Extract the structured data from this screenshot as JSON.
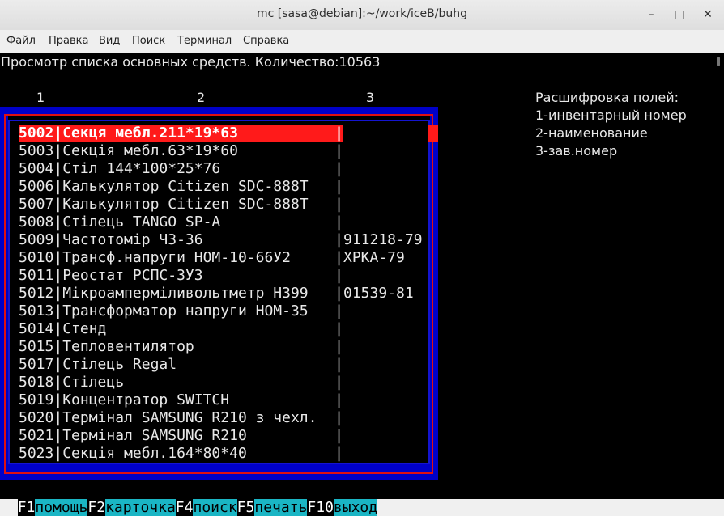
{
  "window": {
    "title": "mc [sasa@debian]:~/work/iceB/buhg"
  },
  "menu": [
    "Файл",
    "Правка",
    "Вид",
    "Поиск",
    "Терминал",
    "Справка"
  ],
  "header": "Просмотр списка основных средств. Количество:10563",
  "columns": [
    "1",
    "2",
    "3"
  ],
  "legend": {
    "title": "Расшифровка полей:",
    "items": [
      "1-инвентарный номер",
      "2-наименование",
      "3-зав.номер"
    ]
  },
  "rows": [
    {
      "num": "5002",
      "name": "Секця мебл.211*19*63",
      "serial": ""
    },
    {
      "num": "5003",
      "name": "Секція мебл.63*19*60",
      "serial": ""
    },
    {
      "num": "5004",
      "name": "Стіл 144*100*25*76",
      "serial": ""
    },
    {
      "num": "5006",
      "name": "Калькулятор Citizen SDC-888T",
      "serial": ""
    },
    {
      "num": "5007",
      "name": "Калькулятор Citizen SDC-888T",
      "serial": ""
    },
    {
      "num": "5008",
      "name": "Стілець TANGO SP-A",
      "serial": ""
    },
    {
      "num": "5009",
      "name": "Частотомір Ч3-36",
      "serial": "911218-79"
    },
    {
      "num": "5010",
      "name": "Трансф.напруги НОМ-10-66У2",
      "serial": "ХРКА-79"
    },
    {
      "num": "5011",
      "name": "Реостат РСПС-3У3",
      "serial": ""
    },
    {
      "num": "5012",
      "name": "Мікроамперміливольтметр Н399",
      "serial": "01539-81"
    },
    {
      "num": "5013",
      "name": "Трансформатор напруги НОМ-35",
      "serial": ""
    },
    {
      "num": "5014",
      "name": "Стенд",
      "serial": ""
    },
    {
      "num": "5015",
      "name": "Тепловентилятор",
      "serial": ""
    },
    {
      "num": "5017",
      "name": "Стілець Regal",
      "serial": ""
    },
    {
      "num": "5018",
      "name": "Стілець",
      "serial": ""
    },
    {
      "num": "5019",
      "name": "Концентратор SWITCH",
      "serial": ""
    },
    {
      "num": "5020",
      "name": "Термінал SAMSUNG R210 з чехл.",
      "serial": ""
    },
    {
      "num": "5021",
      "name": "Термінал SAMSUNG R210",
      "serial": ""
    },
    {
      "num": "5023",
      "name": "Секція мебл.164*80*40",
      "serial": ""
    }
  ],
  "fkeys": [
    {
      "key": "F1",
      "label": "помощь"
    },
    {
      "key": "F2",
      "label": "карточка"
    },
    {
      "key": "F4",
      "label": "поиск"
    },
    {
      "key": "F5",
      "label": "печать"
    },
    {
      "key": "F10",
      "label": "выход"
    }
  ],
  "colors": {
    "selection": "#ff1a1a",
    "panel": "#0000c8",
    "fkey_label": "#1ab5c4"
  }
}
